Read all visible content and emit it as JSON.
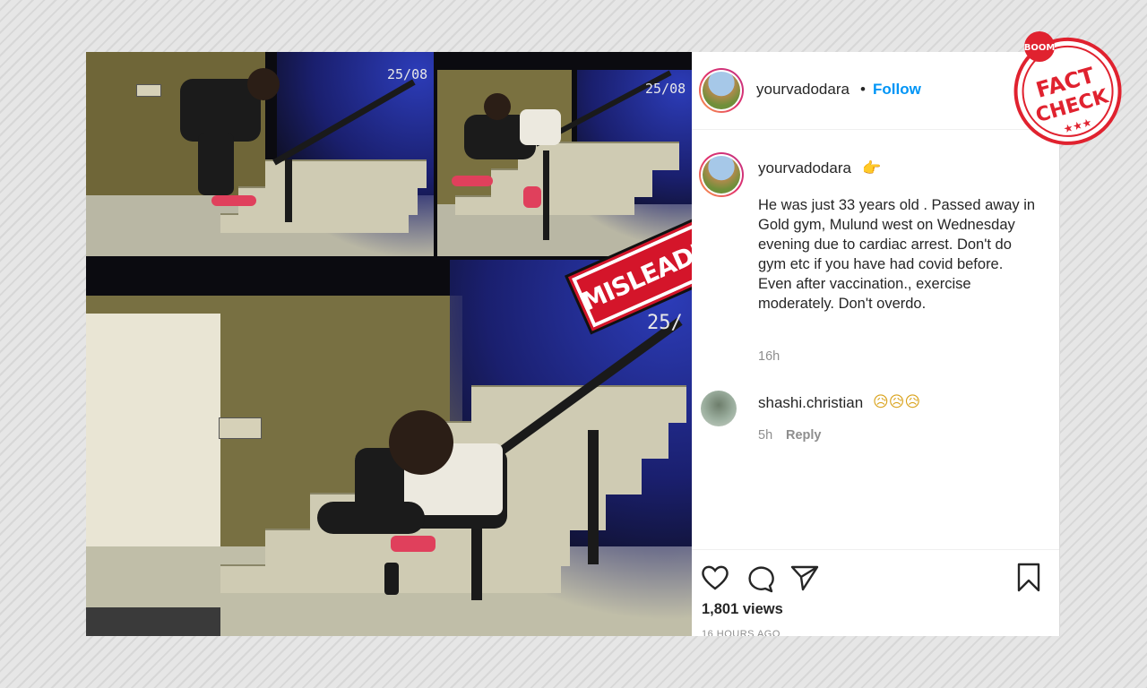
{
  "post": {
    "header": {
      "username": "yourvadodara",
      "separator": "•",
      "follow_label": "Follow"
    },
    "caption": {
      "username": "yourvadodara",
      "emoji": "👉",
      "text": "He was just 33 years old . Passed away in Gold gym, Mulund west on Wednesday evening due to cardiac arrest. Don't do gym etc if you have had covid before. Even after vaccination., exercise moderately. Don't overdo.",
      "time": "16h"
    },
    "comments": [
      {
        "username": "shashi.christian",
        "text": "😥😥😥",
        "time": "5h",
        "reply_label": "Reply"
      }
    ],
    "views": "1,801 views",
    "posted_ago": "16 HOURS AGO"
  },
  "media": {
    "timestamps": [
      "25/08",
      "25/08",
      "25/"
    ],
    "stamp_text": "MISLEADING"
  },
  "badge": {
    "top_text": "BOOM",
    "line1": "FACT",
    "line2": "CHECK",
    "stars": "★★★",
    "color": "#e0222f"
  },
  "icons": [
    "heart-icon",
    "comment-icon",
    "share-icon",
    "bookmark-icon"
  ],
  "colors": {
    "link": "#0095f6",
    "stamp": "#d4152a",
    "text": "#262626",
    "muted": "#8e8e8e"
  }
}
